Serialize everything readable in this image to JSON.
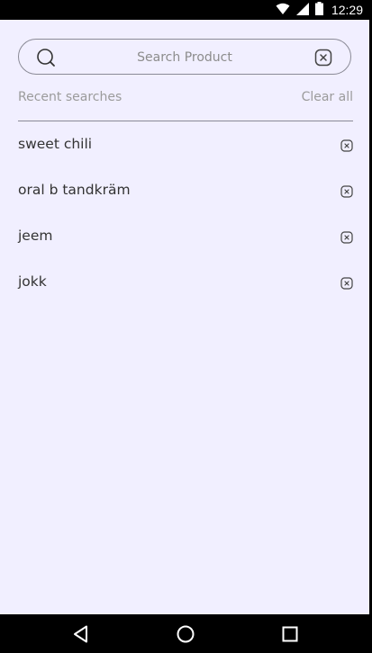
{
  "status_bar": {
    "time": "12:29",
    "icons": [
      "wifi-icon",
      "cellular-signal-icon",
      "battery-icon"
    ]
  },
  "search": {
    "placeholder": "Search Product",
    "value": "",
    "left_icon": "search-icon",
    "right_icon": "clear-search-icon"
  },
  "recent": {
    "title": "Recent searches",
    "clear_all_label": "Clear all",
    "items": [
      {
        "label": "sweet chili",
        "icon": "remove-icon"
      },
      {
        "label": "oral b tandkräm",
        "icon": "remove-icon"
      },
      {
        "label": "jeem",
        "icon": "remove-icon"
      },
      {
        "label": "jokk",
        "icon": "remove-icon"
      }
    ]
  },
  "nav_bar": {
    "buttons": [
      "back-icon",
      "home-icon",
      "recents-icon"
    ]
  },
  "colors": {
    "background": "#f1efff",
    "border": "#8a8a96",
    "muted_text": "#9b9b9b",
    "text": "#333333"
  }
}
